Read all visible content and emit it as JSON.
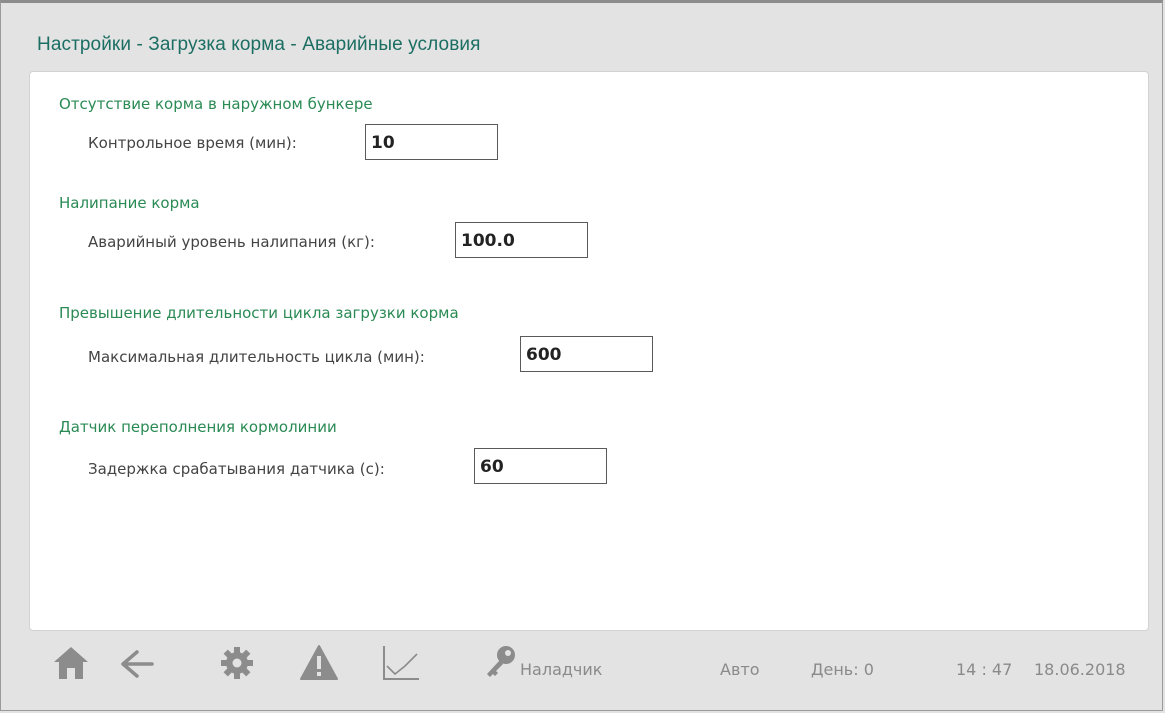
{
  "header": {
    "title": "Настройки - Загрузка корма - Аварийные условия"
  },
  "sections": [
    {
      "title": "Отсутствие корма в наружном бункере",
      "label": "Контрольное время (мин):",
      "value": "10"
    },
    {
      "title": "Налипание корма",
      "label": "Аварийный уровень налипания (кг):",
      "value": "100.0"
    },
    {
      "title": "Превышение длительности цикла загрузки корма",
      "label": "Максимальная длительность цикла (мин):",
      "value": "600"
    },
    {
      "title": "Датчик переполнения кормолинии",
      "label": "Задержка срабатывания датчика (с):",
      "value": "60"
    }
  ],
  "footer": {
    "icons": [
      "home-icon",
      "back-arrow-icon",
      "gear-icon",
      "warning-icon",
      "chart-icon",
      "key-icon"
    ],
    "user": "Наладчик",
    "mode": "Авто",
    "day": "День: 0",
    "time": "14 : 47",
    "date": "18.06.2018",
    "icon_color": "#8c8c8c",
    "accent_color": "#1c6e63"
  }
}
